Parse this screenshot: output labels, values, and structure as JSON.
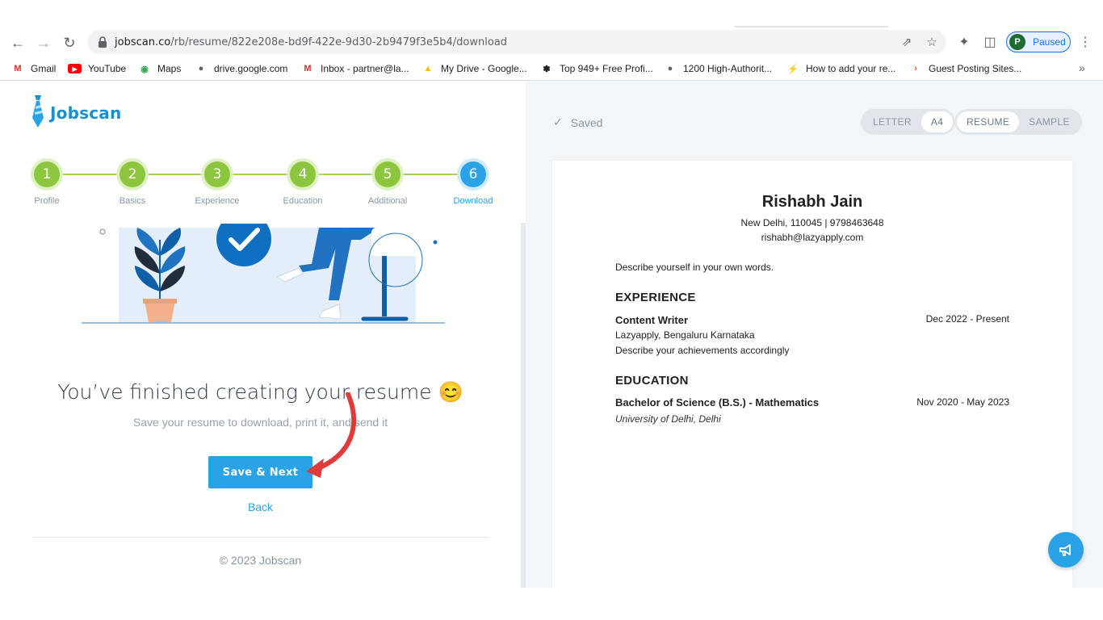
{
  "browser": {
    "url_domain": "jobscan.co",
    "url_path": "/rb/resume/822e208e-bd9f-422e-9d30-2b9479f3e5b4/download",
    "profile_initial": "P",
    "profile_status": "Paused",
    "bookmarks": [
      {
        "label": "Gmail",
        "icon": "gmail-icon"
      },
      {
        "label": "YouTube",
        "icon": "youtube-icon"
      },
      {
        "label": "Maps",
        "icon": "maps-icon"
      },
      {
        "label": "drive.google.com",
        "icon": "globe-icon"
      },
      {
        "label": "Inbox - partner@la...",
        "icon": "gmail-icon"
      },
      {
        "label": "My Drive - Google...",
        "icon": "drive-icon"
      },
      {
        "label": "Top 949+ Free Profi...",
        "icon": "feed-icon"
      },
      {
        "label": "1200 High-Authorit...",
        "icon": "globe-icon"
      },
      {
        "label": "How to add your re...",
        "icon": "bolt-icon"
      },
      {
        "label": "Guest Posting Sites...",
        "icon": "arrow-icon"
      }
    ]
  },
  "brand": {
    "name": "Jobscan"
  },
  "stepper": {
    "steps": [
      {
        "num": "1",
        "label": "Profile"
      },
      {
        "num": "2",
        "label": "Basics"
      },
      {
        "num": "3",
        "label": "Experience"
      },
      {
        "num": "4",
        "label": "Education"
      },
      {
        "num": "5",
        "label": "Additional"
      },
      {
        "num": "6",
        "label": "Download"
      }
    ],
    "active_index": 5
  },
  "finish": {
    "title": "You’ve finished creating your resume 😊",
    "subtitle": "Save your resume to download, print it, and send it",
    "save_button": "Save & Next",
    "back_link": "Back",
    "copyright": "© 2023 Jobscan"
  },
  "preview": {
    "saved_label": "Saved",
    "paper_options": [
      "LETTER",
      "A4"
    ],
    "paper_selected": "A4",
    "mode_options": [
      "RESUME",
      "SAMPLE"
    ],
    "mode_selected": "RESUME"
  },
  "resume": {
    "name": "Rishabh Jain",
    "location_phone": "New Delhi, 110045 | 9798463648",
    "email": "rishabh@lazyapply.com",
    "summary": "Describe yourself in your own words.",
    "experience_heading": "EXPERIENCE",
    "job_title": "Content Writer",
    "job_dates": "Dec 2022 - Present",
    "job_company": "Lazyapply, Bengaluru Karnataka",
    "job_desc": "Describe your achievements accordingly",
    "education_heading": "EDUCATION",
    "degree": "Bachelor of Science (B.S.) - Mathematics",
    "degree_dates": "Nov 2020 - May 2023",
    "school": "University of Delhi, Delhi"
  },
  "colors": {
    "accent": "#2aa3e6",
    "step_done": "#8cc63f",
    "annotation_arrow": "#e03a3a"
  }
}
